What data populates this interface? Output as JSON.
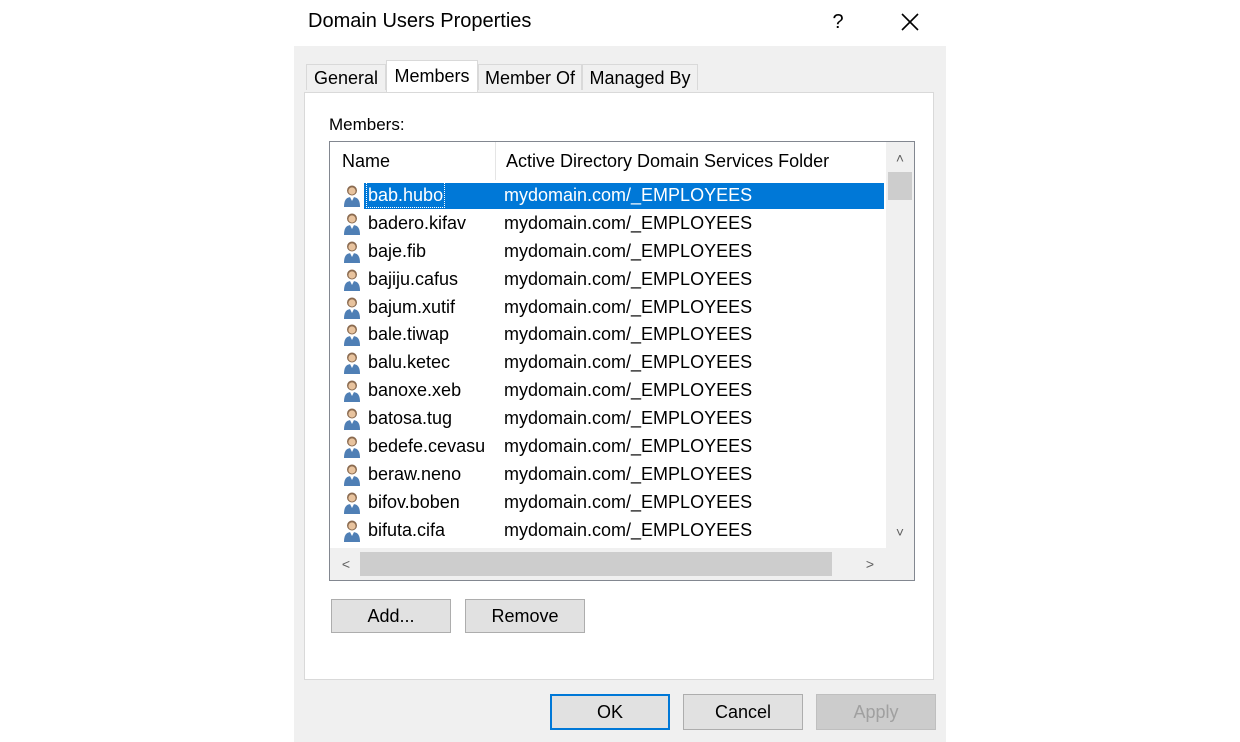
{
  "window": {
    "title": "Domain Users Properties",
    "help_glyph": "?",
    "close_icon": "close-icon"
  },
  "tabs": [
    {
      "label": "General",
      "active": false
    },
    {
      "label": "Members",
      "active": true
    },
    {
      "label": "Member Of",
      "active": false
    },
    {
      "label": "Managed By",
      "active": false
    }
  ],
  "members": {
    "label": "Members:",
    "columns": [
      "Name",
      "Active Directory Domain Services Folder"
    ],
    "rows": [
      {
        "name": "bab.hubo",
        "folder": "mydomain.com/_EMPLOYEES",
        "selected": true
      },
      {
        "name": "badero.kifav",
        "folder": "mydomain.com/_EMPLOYEES"
      },
      {
        "name": "baje.fib",
        "folder": "mydomain.com/_EMPLOYEES"
      },
      {
        "name": "bajiju.cafus",
        "folder": "mydomain.com/_EMPLOYEES"
      },
      {
        "name": "bajum.xutif",
        "folder": "mydomain.com/_EMPLOYEES"
      },
      {
        "name": "bale.tiwap",
        "folder": "mydomain.com/_EMPLOYEES"
      },
      {
        "name": "balu.ketec",
        "folder": "mydomain.com/_EMPLOYEES"
      },
      {
        "name": "banoxe.xeb",
        "folder": "mydomain.com/_EMPLOYEES"
      },
      {
        "name": "batosa.tug",
        "folder": "mydomain.com/_EMPLOYEES"
      },
      {
        "name": "bedefe.cevasu",
        "folder": "mydomain.com/_EMPLOYEES"
      },
      {
        "name": "beraw.neno",
        "folder": "mydomain.com/_EMPLOYEES"
      },
      {
        "name": "bifov.boben",
        "folder": "mydomain.com/_EMPLOYEES"
      },
      {
        "name": "bifuta.cifa",
        "folder": "mydomain.com/_EMPLOYEES"
      }
    ],
    "row_icon": "user-icon",
    "add_label": "Add...",
    "remove_label": "Remove"
  },
  "footer": {
    "ok_label": "OK",
    "cancel_label": "Cancel",
    "apply_label": "Apply"
  },
  "colors": {
    "selection": "#0078d7",
    "dialog_bg": "#f0f0f0"
  }
}
